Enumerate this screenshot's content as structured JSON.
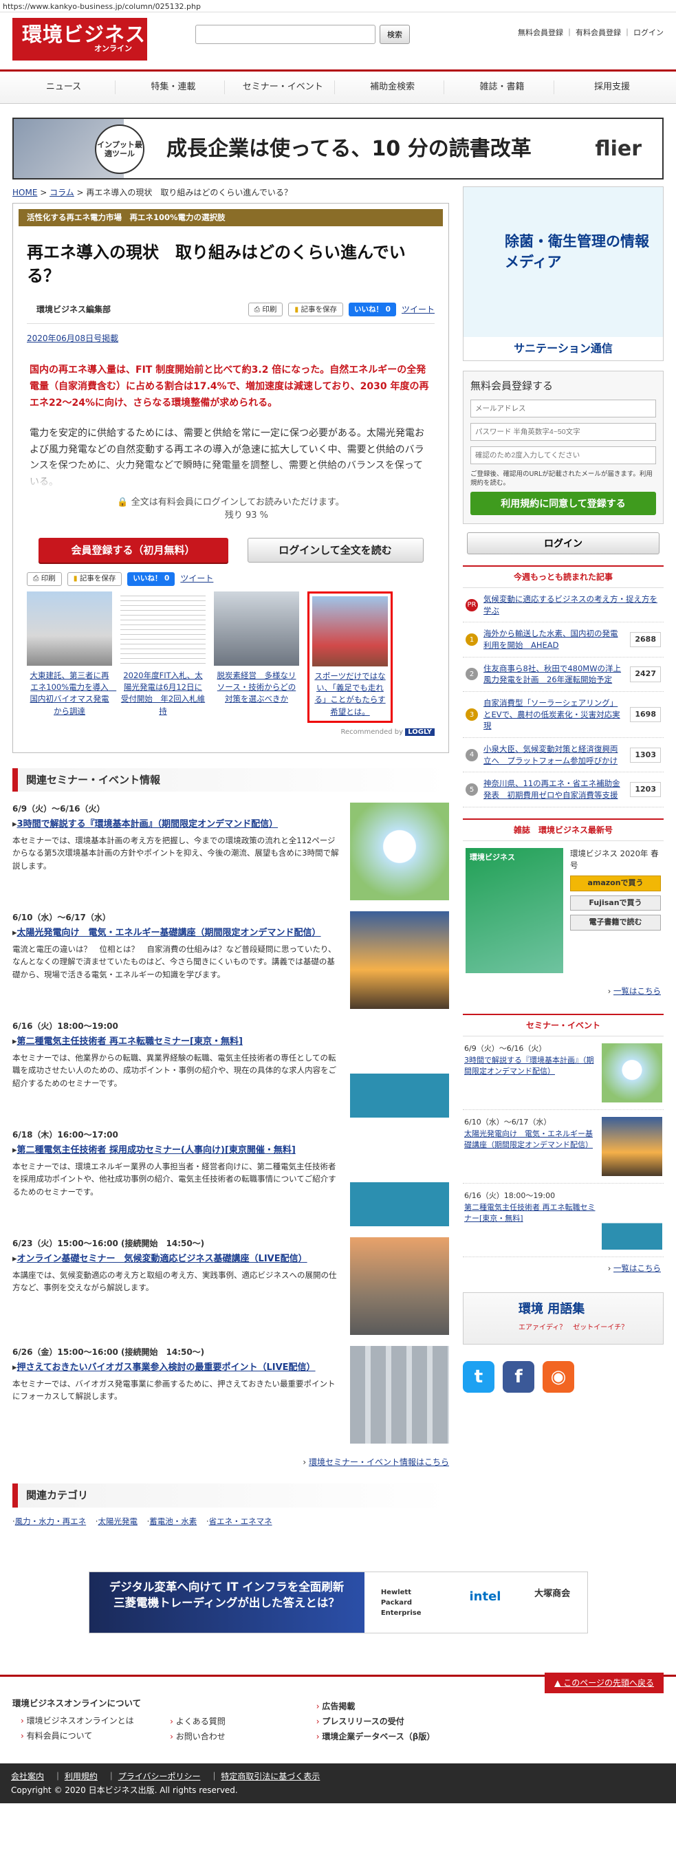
{
  "url": "https://www.kankyo-business.jp/column/025132.php",
  "logo": {
    "main": "環境ビジネス",
    "sub": "オンライン"
  },
  "search": {
    "button": "検索"
  },
  "header_links": [
    "無料会員登録",
    "有料会員登録",
    "ログイン"
  ],
  "nav": [
    "ニュース",
    "特集・連載",
    "セミナー・イベント",
    "補助金検索",
    "雑誌・書籍",
    "採用支援"
  ],
  "top_banner": {
    "badge": "インプット最適ツール",
    "text": "成長企業は使ってる、10 分の読書改革",
    "brand": "flier"
  },
  "breadcrumb": {
    "home": "HOME",
    "col": "コラム",
    "current": "再エネ導入の現状　取り組みはどのくらい進んでいる？"
  },
  "article": {
    "subtitle": "活性化する再エネ電力市場　再エネ100%電力の選択肢",
    "title": "再エネ導入の現状　取り組みはどのくらい進んでいる？",
    "author": "環境ビジネス編集部",
    "print": "印刷",
    "save": "記事を保存",
    "like": "いいね！ 0",
    "tweet": "ツイート",
    "date": "2020年06月08日号掲載",
    "lead": "国内の再エネ導入量は、FIT 制度開始前と比べて約3.2 倍になった。自然エネルギーの全発電量（自家消費含む）に占める割合は17.4%で、増加速度は減速しており、2030 年度の再エネ22～24%に向け、さらなる環境整備が求められる。",
    "body": "電力を安定的に供給するためには、需要と供給を常に一定に保つ必要がある。太陽光発電および風力発電などの自然変動する再エネの導入が急速に拡大していく中、需要と供給のバランスを保つために、火力発電などで瞬時に発電量を調整し、需要と供給のバランスを保っている。",
    "lock": "全文は有料会員にログインしてお読みいただけます。",
    "remain": "残り 93 %",
    "cta_register": "会員登録する（初月無料）",
    "cta_login": "ログインして全文を読む"
  },
  "recs": [
    {
      "title": "大東建託、第三者に再エネ100%電力を導入　国内初バイオマス発電から調達"
    },
    {
      "title": "2020年度FIT入札、太陽光発電は6月12日に受付開始　年2回入札維持"
    },
    {
      "title": "脱炭素経営　多様なリソース・技術からどの対策を選ぶべきか"
    },
    {
      "title": "スポーツだけではない、「義足でも走れる」ことがもたらす希望とは。"
    }
  ],
  "recommend": {
    "label": "Recommended by",
    "brand": "LOGLY"
  },
  "seminars_section": "関連セミナー・イベント情報",
  "seminars": [
    {
      "date": "6/9（火）～6/16（火）",
      "title": "3時間で解説する『環境基本計画』（期間限定オンデマンド配信）",
      "desc": "本セミナーでは、環境基本計画の考え方を把握し、今までの環境政策の流れと全112ページからなる第5次環境基本計画の方針やポイントを抑え、今後の潮流、展望も含めに3時間で解説します。"
    },
    {
      "date": "6/10（水）～6/17（水）",
      "title": "太陽光発電向け　電気・エネルギー基礎講座（期間限定オンデマンド配信）",
      "desc": "電流と電圧の違いは？　位相とは？　自家消費の仕組みは？など普段疑問に思っていたり、なんとなくの理解で済ませていたものはど、今さら聞きにくいものです。講義では基礎の基礎から、現場で活きる電気・エネルギーの知識を学びます。"
    },
    {
      "date": "6/16（火）18:00～19:00",
      "title": "第二種電気主任技術者 再エネ転職セミナー[東京・無料]",
      "desc": "本セミナーでは、他業界からの転職、異業界経験の転職、電気主任技術者の専任としての転職を成功させたい人のための、成功ポイント・事例の紹介や、現在の具体的な求人内容をご紹介するためのセミナーです。"
    },
    {
      "date": "6/18（木）16:00～17:00",
      "title": "第二種電気主任技術者 採用成功セミナー(人事向け)[東京開催・無料]",
      "desc": "本セミナーでは、環境エネルギー業界の人事担当者・経営者向けに、第二種電気主任技術者を採用成功ポイントや、他社成功事例の紹介、電気主任技術者の転職事情についてご紹介するためのセミナーです。"
    },
    {
      "date": "6/23（火）15:00～16:00 (接続開始　14:50～)",
      "title": "オンライン基礎セミナー　気候変動適応ビジネス基礎講座（LIVE配信）",
      "desc": "本講座では、気候変動適応の考え方と取組の考え方、実践事例、適応ビジネスへの展開の仕方など、事例を交えながら解説します。"
    },
    {
      "date": "6/26（金）15:00～16:00 (接続開始　14:50～)",
      "title": "押さえておきたいバイオガス事業参入検討の最重要ポイント（LIVE配信）",
      "desc": "本セミナーでは、バイオガス発電事業に参画するために、押さえておきたい最重要ポイントにフォーカスして解説します。"
    }
  ],
  "seminars_more": "環境セミナー・イベント情報はこちら",
  "cats_section": "関連カテゴリ",
  "cats": [
    "風力・水力・再エネ",
    "太陽光発電",
    "蓄電池・水素",
    "省エネ・エネマネ"
  ],
  "side_ad": {
    "text": "除菌・衛生管理の情報メディア",
    "brand": "サニテーション通信"
  },
  "reg": {
    "title": "無料会員登録する",
    "email_ph": "メールアドレス",
    "pw_ph": "パスワード 半角英数字4~50文字",
    "pw2_ph": "確認のため2度入力してください",
    "note": "ご登録後、確認用のURLが記載されたメールが届きます。利用規約を読む。",
    "button": "利用規約に同意して登録する"
  },
  "login": "ログイン",
  "rank_title": "今週もっとも読まれた記事",
  "ranking": [
    {
      "n": "PR",
      "title": "気候変動に適応するビジネスの考え方・捉え方を学ぶ",
      "count": ""
    },
    {
      "n": "1",
      "title": "海外から輸送した水素、国内初の発電利用を開始　AHEAD",
      "count": "2688"
    },
    {
      "n": "2",
      "title": "住友商事ら8社、秋田で480MWの洋上風力発電を計画　26年運転開始予定",
      "count": "2427"
    },
    {
      "n": "3",
      "title": "自家消費型「ソーラーシェアリング」とEVで、農村の低炭素化・災害対応実現",
      "count": "1698"
    },
    {
      "n": "4",
      "title": "小泉大臣、気候変動対策と経済復興両立へ　プラットフォーム参加呼びかけ",
      "count": "1303"
    },
    {
      "n": "5",
      "title": "神奈川県、11の再エネ・省エネ補助金発表　初期費用ゼロや自家消費等支援",
      "count": "1203"
    }
  ],
  "mag": {
    "title": "雑誌　環境ビジネス最新号",
    "issue": "環境ビジネス 2020年 春号",
    "cover": "環境ビジネス",
    "amazon": "amazonで買う",
    "fujisan": "Fujisanで買う",
    "ebook": "電子書籍で読む",
    "more": "一覧はこちら"
  },
  "ssem_title": "セミナー・イベント",
  "ssem": [
    {
      "date": "6/9（火）～6/16（火）",
      "title": "3時間で解説する『環境基本計画』（期間限定オンデマンド配信）"
    },
    {
      "date": "6/10（水）～6/17（水）",
      "title": "太陽光発電向け　電気・エネルギー基礎講座（期間限定オンデマンド配信）"
    },
    {
      "date": "6/16（火）18:00～19:00",
      "title": "第二種電気主任技術者 再エネ転職セミナー[東京・無料]"
    }
  ],
  "ssem_more": "一覧はこちら",
  "gloss": {
    "title": "環境 用語集",
    "words": "エアァイディ？　ゼットイーイチ？"
  },
  "bottom_ad": {
    "text": "デジタル変革へ向けて IT インフラを全面刷新 三菱電機トレーディングが出した答えとは？",
    "b1": "Hewlett Packard Enterprise",
    "b2": "intel",
    "b3": "大塚商会"
  },
  "backtop": "このページの先頭へ戻る",
  "footer": {
    "col1_title": "環境ビジネスオンラインについて",
    "col1": [
      "環境ビジネスオンラインとは",
      "有料会員について"
    ],
    "col2": [
      "よくある質問",
      "お問い合わせ"
    ],
    "col3": [
      "広告掲載",
      "プレスリリースの受付",
      "環境企業データベース（β版）"
    ],
    "bar": [
      "会社案内",
      "利用規約",
      "プライバシーポリシー",
      "特定商取引法に基づく表示"
    ],
    "copyright": "Copyright © 2020 日本ビジネス出版. All rights reserved."
  }
}
